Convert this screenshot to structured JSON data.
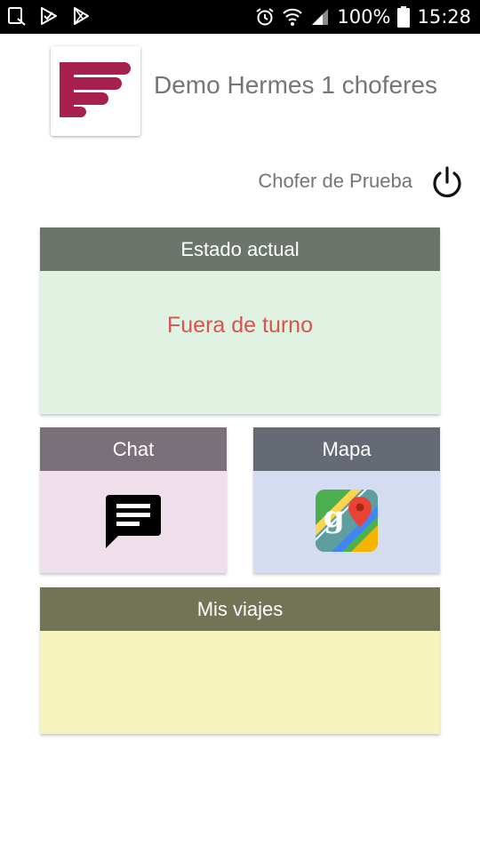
{
  "status_bar": {
    "battery_text": "100%",
    "time": "15:28",
    "icons": [
      "notification-icon",
      "check-app-icon",
      "play-store-icon",
      "alarm-icon",
      "wifi-icon",
      "signal-icon",
      "battery-icon"
    ]
  },
  "header": {
    "logo_icon": "hermes-logo-icon",
    "app_title": "Demo Hermes 1 choferes",
    "user_name": "Chofer de Prueba",
    "power_icon": "power-icon"
  },
  "cards": {
    "status": {
      "title": "Estado actual",
      "value": "Fuera de turno",
      "value_color": "#d9534f"
    },
    "chat": {
      "title": "Chat",
      "icon": "chat-icon"
    },
    "map": {
      "title": "Mapa",
      "icon": "maps-icon"
    },
    "trips": {
      "title": "Mis viajes"
    }
  },
  "colors": {
    "status_header": "#6b756b",
    "status_body": "#e0f2e1",
    "chat_header": "#79707a",
    "chat_body": "#eedfeb",
    "map_header": "#656a75",
    "map_body": "#d3dcf0",
    "trips_header": "#737356",
    "trips_body": "#f6f4bc",
    "logo_brand": "#a8214d"
  }
}
